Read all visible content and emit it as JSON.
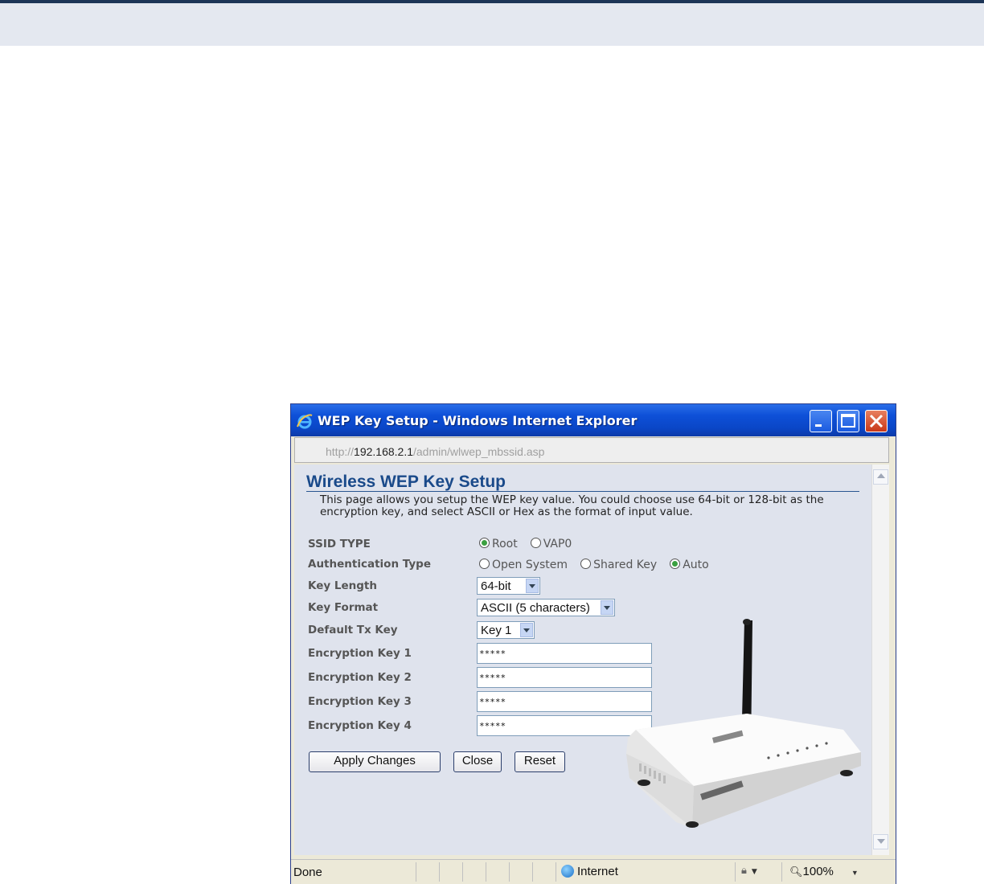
{
  "window": {
    "title": "WEP Key Setup - Windows Internet Explorer",
    "address_prefix": "http://",
    "address_host": "192.168.2.1",
    "address_path": "/admin/wlwep_mbssid.asp"
  },
  "page": {
    "heading": "Wireless WEP Key Setup",
    "description": "This page allows you setup the WEP key value. You could choose use 64-bit or 128-bit as the encryption key, and select ASCII or Hex as the format of input value."
  },
  "form": {
    "ssid_type": {
      "label": "SSID TYPE",
      "options": [
        "Root",
        "VAP0"
      ],
      "selected": "Root"
    },
    "auth_type": {
      "label": "Authentication Type",
      "options": [
        "Open System",
        "Shared Key",
        "Auto"
      ],
      "selected": "Auto"
    },
    "key_length": {
      "label": "Key Length",
      "value": "64-bit"
    },
    "key_format": {
      "label": "Key Format",
      "value": "ASCII (5 characters)"
    },
    "default_tx_key": {
      "label": "Default Tx Key",
      "value": "Key 1"
    },
    "keys": [
      {
        "label": "Encryption Key 1",
        "value": "*****"
      },
      {
        "label": "Encryption Key 2",
        "value": "*****"
      },
      {
        "label": "Encryption Key 3",
        "value": "*****"
      },
      {
        "label": "Encryption Key 4",
        "value": "*****"
      }
    ],
    "buttons": {
      "apply": "Apply Changes",
      "close": "Close",
      "reset": "Reset"
    }
  },
  "statusbar": {
    "status": "Done",
    "zone": "Internet",
    "zoom": "100%"
  },
  "icons": [
    "ie-logo-icon",
    "minimize-icon",
    "maximize-icon",
    "close-icon",
    "globe-icon",
    "protected-mode-icon",
    "zoom-icon"
  ],
  "colors": {
    "titlebar": "#0a46c6",
    "heading": "#1a4a8a",
    "content_bg": "#dfe3ed",
    "radio_on": "#3aa040"
  }
}
